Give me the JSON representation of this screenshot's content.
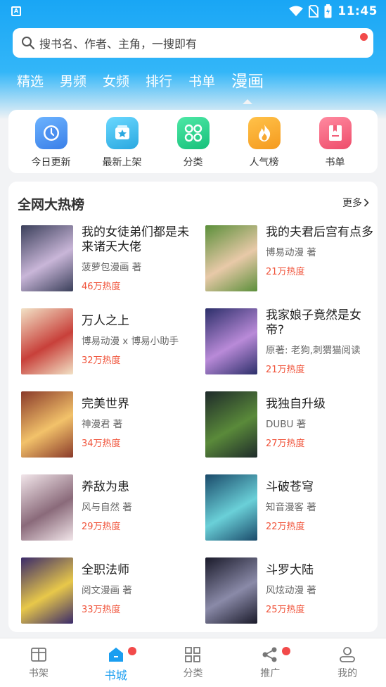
{
  "status_bar": {
    "time": "11:45"
  },
  "search": {
    "placeholder": "搜书名、作者、主角，一搜即有"
  },
  "tabs": [
    {
      "label": "精选"
    },
    {
      "label": "男频"
    },
    {
      "label": "女频"
    },
    {
      "label": "排行"
    },
    {
      "label": "书单"
    },
    {
      "label": "漫画"
    }
  ],
  "quick_entries": [
    {
      "label": "今日更新",
      "icon": "clock-icon",
      "color": "#4a8ff0"
    },
    {
      "label": "最新上架",
      "icon": "star-box-icon",
      "color": "#38b8e8"
    },
    {
      "label": "分类",
      "icon": "grid-icon",
      "color": "#2ccf8c"
    },
    {
      "label": "人气榜",
      "icon": "flame-icon",
      "color": "#f7a832"
    },
    {
      "label": "书单",
      "icon": "bookmark-icon",
      "color": "#f2607a"
    }
  ],
  "hot": {
    "title": "全网大热榜",
    "more": "更多",
    "books": [
      {
        "title": "我的女徒弟们都是未来诸天大佬",
        "author": "菠萝包漫画 著",
        "heat": "46万热度",
        "c1": "#3a3f5a",
        "c2": "#c9b6d8"
      },
      {
        "title": "我的夫君后宫有点多",
        "author": "博易动漫 著",
        "heat": "21万热度",
        "c1": "#5b8f3a",
        "c2": "#e8c9a8"
      },
      {
        "title": "万人之上",
        "author": "博易动漫 x 博易小助手",
        "heat": "32万热度",
        "c1": "#f2e2c6",
        "c2": "#c8403a"
      },
      {
        "title": "我家娘子竟然是女帝?",
        "author": "原著: 老狗,刺猬猫阅读",
        "heat": "21万热度",
        "c1": "#2c2f6a",
        "c2": "#b98ad8"
      },
      {
        "title": "完美世界",
        "author": "神漫君 著",
        "heat": "34万热度",
        "c1": "#8a3a2a",
        "c2": "#f2c26a"
      },
      {
        "title": "我独自升级",
        "author": "DUBU 著",
        "heat": "27万热度",
        "c1": "#1e2a2a",
        "c2": "#5a8a3a"
      },
      {
        "title": "养敌为患",
        "author": "风与自然 著",
        "heat": "29万热度",
        "c1": "#f2e6ea",
        "c2": "#8a6a7a"
      },
      {
        "title": "斗破苍穹",
        "author": "知音漫客 著",
        "heat": "22万热度",
        "c1": "#1a4a6a",
        "c2": "#6ad0d8"
      },
      {
        "title": "全职法师",
        "author": "阅文漫画 著",
        "heat": "33万热度",
        "c1": "#3a2a6a",
        "c2": "#e8c84a"
      },
      {
        "title": "斗罗大陆",
        "author": "风炫动漫 著",
        "heat": "25万热度",
        "c1": "#1a1a2a",
        "c2": "#8a8aa8"
      }
    ]
  },
  "bottom_nav": [
    {
      "label": "书架",
      "icon": "shelf-icon"
    },
    {
      "label": "书城",
      "icon": "home-icon",
      "active": true
    },
    {
      "label": "分类",
      "icon": "category-icon"
    },
    {
      "label": "推广",
      "icon": "share-icon"
    },
    {
      "label": "我的",
      "icon": "user-icon"
    }
  ],
  "colors": {
    "accent": "#1a9ef0",
    "heat": "#f0533a",
    "badge": "#f24a4a"
  }
}
